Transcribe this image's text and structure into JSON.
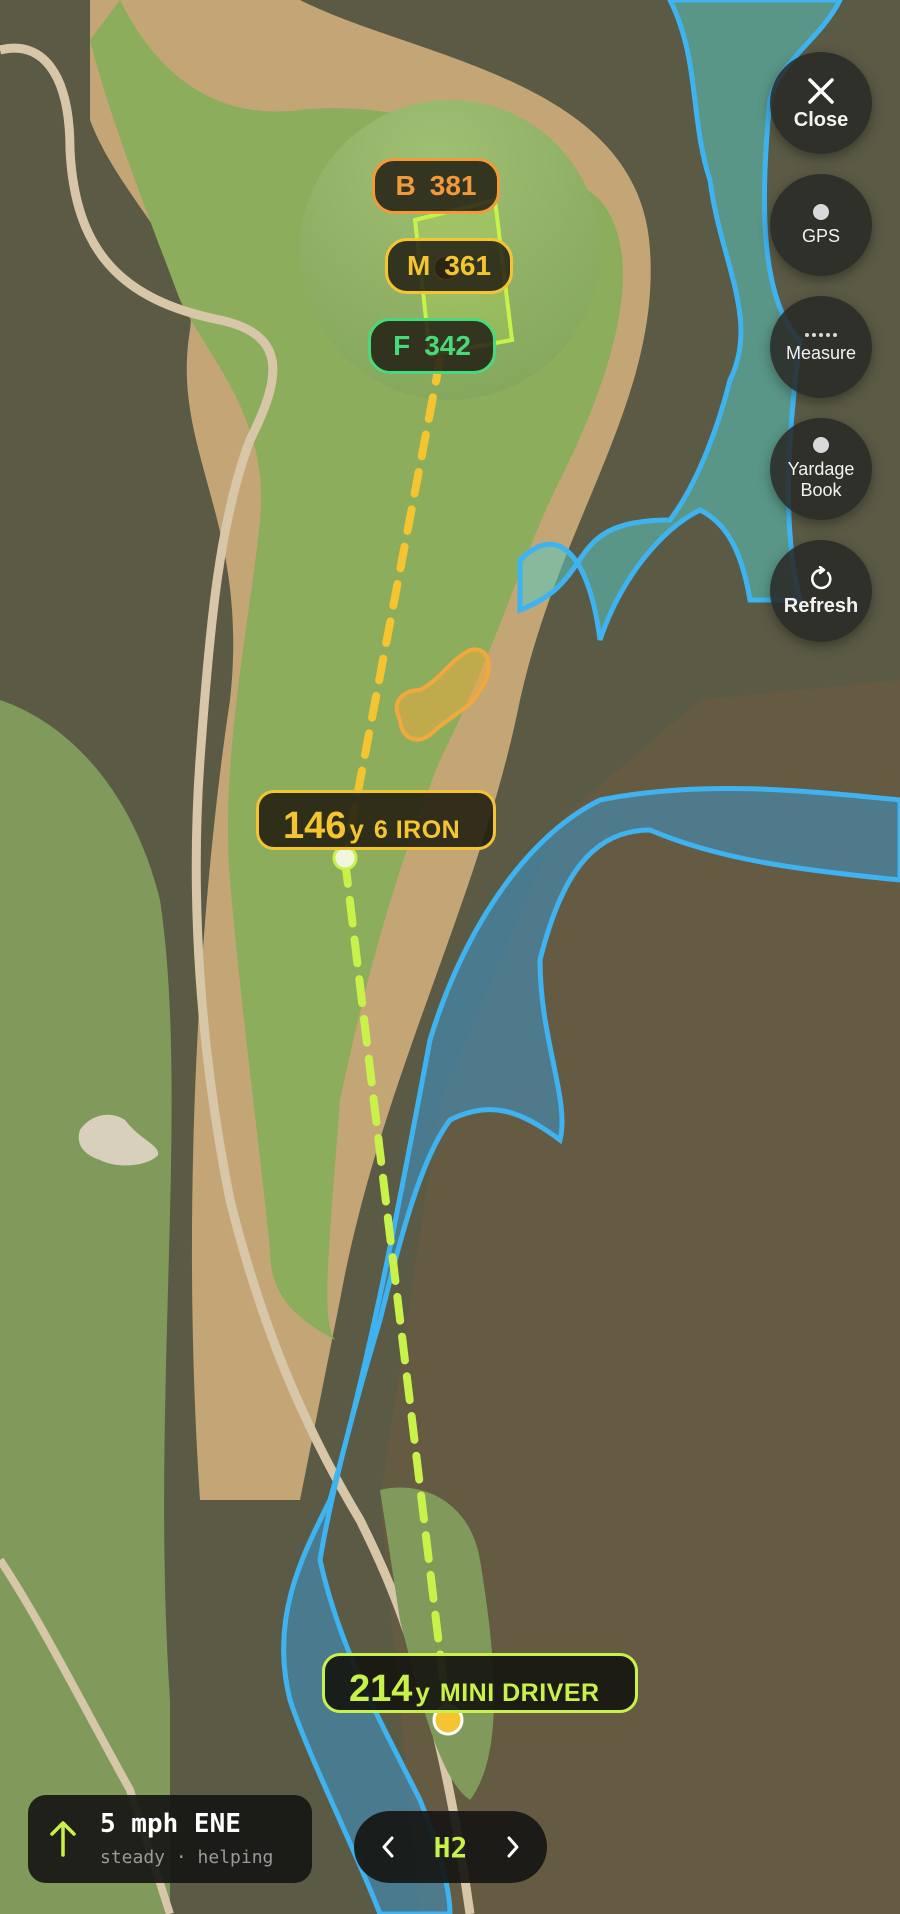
{
  "controls": {
    "close": {
      "label": "Close",
      "icon": "close-icon"
    },
    "gps": {
      "label": "GPS",
      "icon": "gps-dot-icon"
    },
    "measure": {
      "label": "Measure",
      "icon": "dotted-line-icon"
    },
    "yardage_book": {
      "label_line1": "Yardage",
      "label_line2": "Book",
      "icon": "book-dot-icon"
    },
    "refresh": {
      "label": "Refresh",
      "icon": "refresh-icon"
    }
  },
  "green_distances": {
    "back": {
      "key": "B",
      "value": "381",
      "color": "#f29a3a"
    },
    "middle": {
      "key": "M",
      "value": "361",
      "color": "#f5c531"
    },
    "front": {
      "key": "F",
      "value": "342",
      "color": "#49d97a"
    }
  },
  "shots": {
    "approach": {
      "distance": "146",
      "unit": "y",
      "club": "6 IRON",
      "color": "#f5c531"
    },
    "tee": {
      "distance": "214",
      "unit": "y",
      "club": "MINI DRIVER",
      "color": "#c8f24a"
    }
  },
  "wind": {
    "speed_text": "5 mph ENE",
    "condition": "steady · helping",
    "icon": "wind-arrow-icon",
    "color": "#c8f24a"
  },
  "hole_nav": {
    "prev_icon": "chevron-left-icon",
    "next_icon": "chevron-right-icon",
    "hole": "H2"
  },
  "hazard_colors": {
    "water": "#3fb3f0",
    "bunker": "#f2a93b",
    "green_outline": "#c8f24a"
  }
}
